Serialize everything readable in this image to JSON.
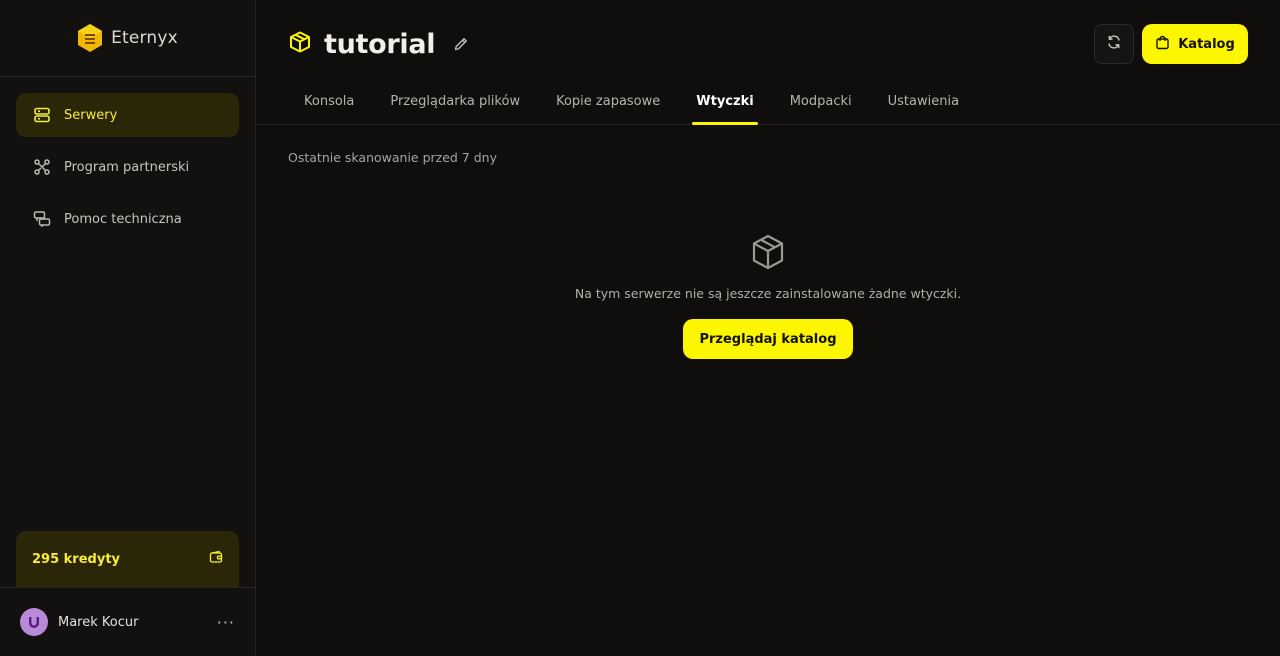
{
  "app": {
    "brand_name": "Eternyx"
  },
  "sidebar": {
    "items": [
      {
        "label": "Serwery",
        "icon": "server-icon",
        "active": true
      },
      {
        "label": "Program partnerski",
        "icon": "nodes-icon",
        "active": false
      },
      {
        "label": "Pomoc techniczna",
        "icon": "chat-bubbles-icon",
        "active": false
      }
    ],
    "credits_label": "295 kredyty",
    "user_name": "Marek Kocur",
    "more_label": "···"
  },
  "header": {
    "server_name": "tutorial",
    "catalog_label": "Katalog"
  },
  "tabs": [
    {
      "label": "Konsola",
      "active": false
    },
    {
      "label": "Przeglądarka plików",
      "active": false
    },
    {
      "label": "Kopie zapasowe",
      "active": false
    },
    {
      "label": "Wtyczki",
      "active": true
    },
    {
      "label": "Modpacki",
      "active": false
    },
    {
      "label": "Ustawienia",
      "active": false
    }
  ],
  "content": {
    "scan_info": "Ostatnie skanowanie przed 7 dny",
    "empty_message": "Na tym serwerze nie są jeszcze zainstalowane żadne wtyczki.",
    "browse_label": "Przeglądaj katalog"
  },
  "colors": {
    "accent": "#fdf601",
    "active_bg": "#2a2607",
    "background": "#0f0e0d",
    "sidebar_bg": "#121110",
    "avatar": "#b98ad8"
  }
}
